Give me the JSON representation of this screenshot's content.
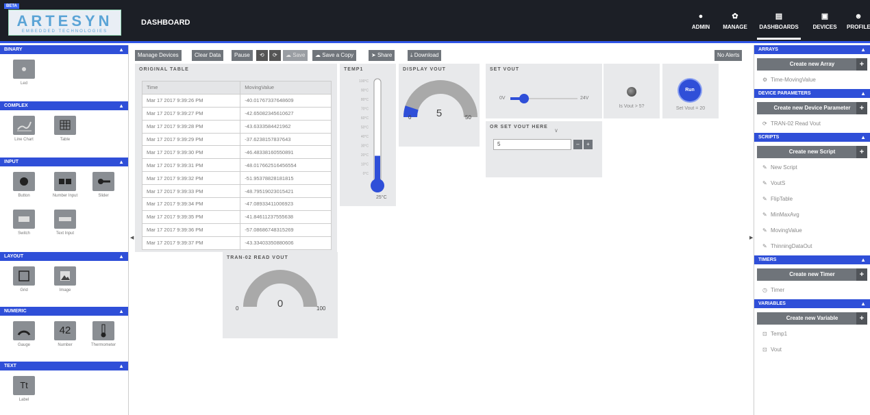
{
  "header": {
    "beta": "BETA",
    "logo_main": "ARTESYN",
    "logo_sub": "EMBEDDED TECHNOLOGIES",
    "page_title": "DASHBOARD",
    "nav": [
      {
        "label": "ADMIN",
        "icon": "●"
      },
      {
        "label": "MANAGE",
        "icon": "✿"
      },
      {
        "label": "DASHBOARDS",
        "icon": "▤"
      },
      {
        "label": "DEVICES",
        "icon": "▣"
      },
      {
        "label": "PROFILE",
        "icon": "☻"
      }
    ]
  },
  "left": {
    "sections": [
      {
        "title": "BINARY",
        "items": [
          {
            "label": "Led",
            "icon": "led-icon"
          }
        ]
      },
      {
        "title": "COMPLEX",
        "items": [
          {
            "label": "Line Chart",
            "icon": "line-chart-icon"
          },
          {
            "label": "Table",
            "icon": "table-icon"
          }
        ]
      },
      {
        "title": "INPUT",
        "items": [
          {
            "label": "Button",
            "icon": "button-icon"
          },
          {
            "label": "Number Input",
            "icon": "number-input-icon"
          },
          {
            "label": "Slider",
            "icon": "slider-icon"
          },
          {
            "label": "Switch",
            "icon": "switch-icon"
          },
          {
            "label": "Text Input",
            "icon": "text-input-icon"
          }
        ]
      },
      {
        "title": "LAYOUT",
        "items": [
          {
            "label": "Grid",
            "icon": "grid-icon"
          },
          {
            "label": "Image",
            "icon": "image-icon"
          }
        ]
      },
      {
        "title": "NUMERIC",
        "items": [
          {
            "label": "Gauge",
            "icon": "gauge-icon"
          },
          {
            "label": "Number",
            "icon": "number-icon",
            "glyph": "42"
          },
          {
            "label": "Thermometer",
            "icon": "thermometer-icon"
          }
        ]
      },
      {
        "title": "TEXT",
        "items": [
          {
            "label": "Label",
            "icon": "label-icon",
            "glyph": "Tt"
          }
        ]
      }
    ]
  },
  "toolbar": [
    "Manage Devices",
    "Clear Data",
    "Pause",
    "⟲",
    "⟳",
    "Save",
    "Save a Copy",
    "Share",
    "Download"
  ],
  "no_alerts": "No Alerts",
  "table": {
    "title": "ORIGINAL TABLE",
    "columns": [
      "Time",
      "MovingValue"
    ],
    "rows": [
      [
        "Mar 17 2017 9:39:26 PM",
        "-40.01767337648609"
      ],
      [
        "Mar 17 2017 9:39:27 PM",
        "-42.65082345610627"
      ],
      [
        "Mar 17 2017 9:39:28 PM",
        "-43.6333584421962"
      ],
      [
        "Mar 17 2017 9:39:29 PM",
        "-37.6238157837643"
      ],
      [
        "Mar 17 2017 9:39:30 PM",
        "-46.48338160550891"
      ],
      [
        "Mar 17 2017 9:39:31 PM",
        "-48.017662516456554"
      ],
      [
        "Mar 17 2017 9:39:32 PM",
        "-51.95378828181815"
      ],
      [
        "Mar 17 2017 9:39:33 PM",
        "-48.79519023015421"
      ],
      [
        "Mar 17 2017 9:39:34 PM",
        "-47.08933411006923"
      ],
      [
        "Mar 17 2017 9:39:35 PM",
        "-41.84611237555638"
      ],
      [
        "Mar 17 2017 9:39:36 PM",
        "-57.08686748315269"
      ],
      [
        "Mar 17 2017 9:39:37 PM",
        "-43.33403350880606"
      ]
    ]
  },
  "temp": {
    "title": "TEMP1",
    "scale": [
      "100°C",
      "90°C",
      "80°C",
      "70°C",
      "60°C",
      "50°C",
      "40°C",
      "30°C",
      "20°C",
      "10°C",
      "0°C"
    ],
    "value": "25°C",
    "level": 0.25
  },
  "display_vout": {
    "title": "DISPLAY VOUT",
    "min": "0",
    "max": "50",
    "value": "5",
    "fraction": 0.1
  },
  "set_vout": {
    "title": "SET VOUT",
    "min": "0V",
    "max": "24V",
    "fraction": 0.2
  },
  "or_set": {
    "title": "OR SET VOUT HERE",
    "value": "5",
    "buttons": [
      "–",
      "+"
    ]
  },
  "led": {
    "label": "Is Vout > 5?"
  },
  "run": {
    "label": "Run",
    "caption": "Set Vout = 20"
  },
  "read_vout": {
    "title": "TRAN-02 READ VOUT",
    "min": "0",
    "max": "100",
    "value": "0",
    "fraction": 0
  },
  "right": {
    "sections": [
      {
        "title": "ARRAYS",
        "create": "Create new Array",
        "items": [
          {
            "label": "Time-MovingValue",
            "icon": "gear-icon",
            "glyph": "⚙"
          }
        ]
      },
      {
        "title": "DEVICE PARAMETERS",
        "create": "Create new Device Parameter",
        "items": [
          {
            "label": "TRAN-02 Read Vout",
            "icon": "parameter-icon",
            "glyph": "⟳"
          }
        ]
      },
      {
        "title": "SCRIPTS",
        "create": "Create new Script",
        "items": [
          {
            "label": "New Script",
            "icon": "edit-icon",
            "glyph": "✎"
          },
          {
            "label": "VoutS",
            "icon": "edit-icon",
            "glyph": "✎"
          },
          {
            "label": "FlipTable",
            "icon": "edit-icon",
            "glyph": "✎"
          },
          {
            "label": "MinMaxAvg",
            "icon": "edit-icon",
            "glyph": "✎"
          },
          {
            "label": "MovingValue",
            "icon": "edit-icon",
            "glyph": "✎"
          },
          {
            "label": "ThinningDataOut",
            "icon": "edit-icon",
            "glyph": "✎"
          }
        ]
      },
      {
        "title": "TIMERS",
        "create": "Create new Timer",
        "items": [
          {
            "label": "Timer",
            "icon": "clock-icon",
            "glyph": "◷"
          }
        ]
      },
      {
        "title": "VARIABLES",
        "create": "Create new Variable",
        "items": [
          {
            "label": "Temp1",
            "icon": "lock-icon",
            "glyph": "🔒"
          },
          {
            "label": "Vout",
            "icon": "lock-icon",
            "glyph": "🔒"
          }
        ]
      }
    ]
  }
}
